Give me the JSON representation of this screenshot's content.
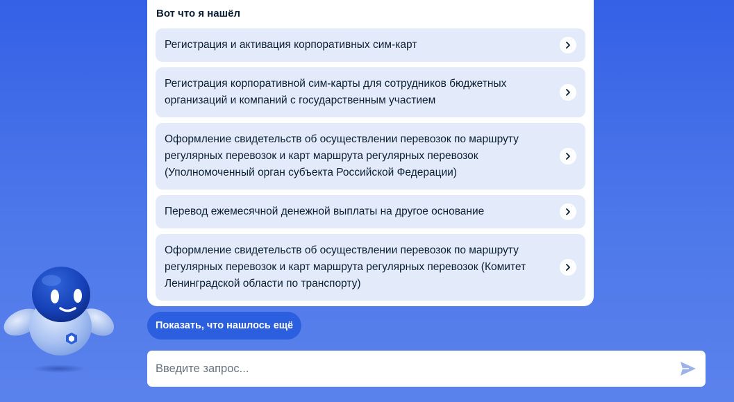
{
  "card": {
    "title": "Вот что я нашёл"
  },
  "results": [
    {
      "text": "Регистрация и активация корпоративных сим-карт"
    },
    {
      "text": "Регистрация корпоративной сим-карты для сотрудников бюджетных организаций и компаний с государственным участием"
    },
    {
      "text": "Оформление свидетельств об осуществлении перевозок по маршруту регулярных перевозок и карт маршрута регулярных перевозок (Уполномоченный орган субъекта Российской Федерации)"
    },
    {
      "text": "Перевод ежемесячной денежной выплаты на другое основание"
    },
    {
      "text": "Оформление свидетельств об осуществлении перевозок по маршруту регулярных перевозок и карт маршрута регулярных перевозок (Комитет Ленинградской области по транспорту)"
    }
  ],
  "more_button": {
    "label": "Показать, что нашлось ещё"
  },
  "search": {
    "value": "",
    "placeholder": "Введите запрос..."
  },
  "icons": {
    "chevron": "chevron-right-icon",
    "send": "send-icon",
    "assistant": "robot-assistant-avatar"
  },
  "colors": {
    "background": "#3d6ae8",
    "accent_button": "#2c5ee0",
    "result_bg": "#e3ebfb",
    "text": "#0b1f33"
  }
}
